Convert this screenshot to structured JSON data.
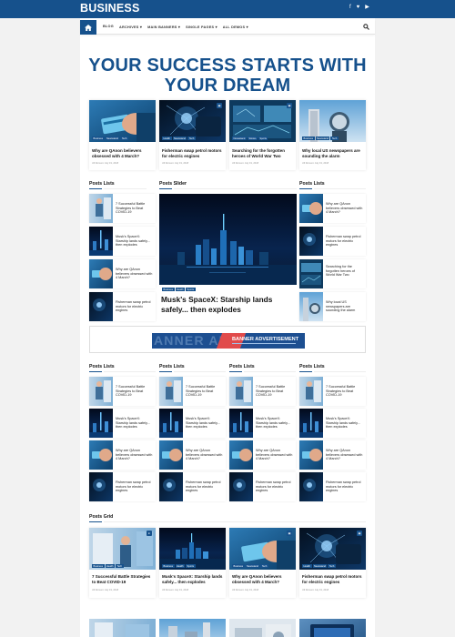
{
  "brand": "BUSINESS",
  "social_icons": [
    "facebook-icon",
    "twitter-icon",
    "youtube-icon"
  ],
  "nav": {
    "items": [
      "BLOG",
      "ARCHIVES",
      "MAIN BANNERS",
      "SINGLE PAGES",
      "ALL DEMOS"
    ]
  },
  "headline": "YOUR SUCCESS STARTS WITH YOUR DREAM",
  "top_cards": [
    {
      "title": "Why are QAnon believers obsessed with 4 March?",
      "tags": [
        "Business",
        "Newsstand",
        "Tech"
      ],
      "meta": "Jill Romero   July 19, 2018"
    },
    {
      "title": "Fisherman swap petrol motors for electric engines",
      "tags": [
        "Health",
        "Newsstand",
        "Tech"
      ],
      "meta": "Jill Romero   July 19, 2018"
    },
    {
      "title": "Searching for the forgotten heroes of World War Two",
      "tags": [
        "Newsstand",
        "Stories",
        "Sports"
      ],
      "meta": "Jill Romero   July 19, 2018"
    },
    {
      "title": "Why local US newspapers are sounding the alarm",
      "tags": [
        "Business",
        "Newsstand",
        "Tech"
      ],
      "meta": "Jill Romero   July 19, 2018"
    }
  ],
  "left_list": {
    "heading": "Posts Lists",
    "items": [
      "7 Successful Battle Strategies to Beat COVID-19",
      "Musk's SpaceX: Starship lands safely... then explodes",
      "Why are QAnon believers obsessed with 4 March?",
      "Fisherman swap petrol motors for electric engines"
    ]
  },
  "slider": {
    "heading": "Posts Slider",
    "tags": [
      "Business",
      "Health",
      "Sports"
    ],
    "title": "Musk's SpaceX: Starship lands safely... then explodes"
  },
  "right_list": {
    "heading": "Posts Lists",
    "items": [
      "Why are QAnon believers obsessed with 4 March?",
      "Fisherman swap petrol motors for electric engines",
      "Searching for the forgotten heroes of World War Two",
      "Why local US newspapers are sounding the alarm"
    ]
  },
  "ad": {
    "text": "BANNER ADVERTISEMENT",
    "bg_letters": "ANNER ADV"
  },
  "lists_row": {
    "heading": "Posts Lists",
    "items": [
      "7 Successful Battle Strategies to Beat COVID-19",
      "Musk's SpaceX: Starship lands safely... then explodes",
      "Why are QAnon believers obsessed with 4 March?",
      "Fisherman swap petrol motors for electric engines"
    ]
  },
  "grid": {
    "heading": "Posts Grid",
    "cards": [
      {
        "title": "7 Successful Battle Strategies to Beat COVID-19",
        "tags": [
          "Business",
          "Health",
          "Tech"
        ],
        "meta": "Jill Romero   July 19, 2018"
      },
      {
        "title": "Musk's SpaceX: Starship lands safely... then explodes",
        "tags": [
          "Business",
          "Health",
          "Sports"
        ],
        "meta": "Jill Romero   July 19, 2018"
      },
      {
        "title": "Why are QAnon believers obsessed with 4 March?",
        "tags": [
          "Business",
          "Newsstand",
          "Tech"
        ],
        "meta": "Jill Romero   July 19, 2018"
      },
      {
        "title": "Fisherman swap petrol motors for electric engines",
        "tags": [
          "Health",
          "Newsstand",
          "Tech"
        ],
        "meta": "Jill Romero   July 19, 2018"
      }
    ]
  },
  "colors": {
    "brand": "#16518c",
    "background": "#f2f2f2"
  }
}
